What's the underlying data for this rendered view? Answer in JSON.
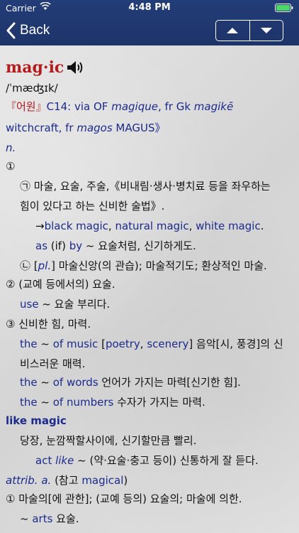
{
  "status": {
    "carrier": "Carrier",
    "time": "4:48 PM"
  },
  "nav": {
    "back_label": "Back"
  },
  "entry": {
    "headword": "mag·ic",
    "pron": "/ˈmæʤɪk/",
    "ety_tag": "『어원』",
    "ety_a": "C14: via OF ",
    "ety_b": "magique",
    "ety_c": ", fr Gk ",
    "ety_d": "magikē",
    "ety2_a": "witchcraft, fr ",
    "ety2_b": "magos",
    "ety2_c": " MAGUS",
    "ety2_d": "》",
    "pos": "n.",
    "s1": "①",
    "s1a": "㉠ 마술, 요술, 주술,《비내림·생사·병치료 등을 좌우하는",
    "s1a2": "힘이 있다고 하는 신비한 술법》.",
    "xr_arrow": "→",
    "xr1": "black magic",
    "comma1": ", ",
    "xr2": "natural magic",
    "comma2": ", ",
    "xr3": "white magic",
    "dot1": ".",
    "ex1_a": "as",
    "ex1_b": " (if) ",
    "ex1_c": "by",
    "ex1_d": " ~ 요술처럼, 신기하게도.",
    "s1b_a": "㉡ [",
    "s1b_b": "pl.",
    "s1b_c": "] 마술신앙(의 관습); 마술적기도; 환상적인 마술.",
    "s2": "② (교예 등에서의) 요술.",
    "ex2_a": "use",
    "ex2_b": " ~ 요술 부리다.",
    "s3": "③ 신비한 힘, 마력.",
    "ex3_a": "the",
    "ex3_b": " ~ ",
    "ex3_c": "of music",
    "ex3_d": " [",
    "ex3_e": "poetry",
    "ex3_f": ", ",
    "ex3_g": "scenery",
    "ex3_h": "] 음악[시, 풍경]의 신",
    "ex3_2": "비스러운 매력.",
    "ex4_a": "the",
    "ex4_b": " ~ ",
    "ex4_c": "of words",
    "ex4_d": " 언어가 가지는 마력[신기한 힘].",
    "ex5_a": "the",
    "ex5_b": " ~ ",
    "ex5_c": "of numbers",
    "ex5_d": " 수자가 가지는 마력.",
    "idiom": "like magic",
    "idiom_def": "당장, 눈깜짝할사이에, 신기할만큼 빨리.",
    "ex6_a": "act",
    "ex6_b": " like",
    "ex6_c": " ~ (약·요술·충고 등이) 신통하게 잘 듣다.",
    "attrib_a": "attrib. a.",
    "attrib_b": " (참고 ",
    "attrib_c": "magical",
    "attrib_d": ")",
    "a1": "① 마술의[에 관한]; (교예 등의) 요술의; 마술에 의한.",
    "ex7_a": "~ ",
    "ex7_b": "arts",
    "ex7_c": " 요술."
  }
}
